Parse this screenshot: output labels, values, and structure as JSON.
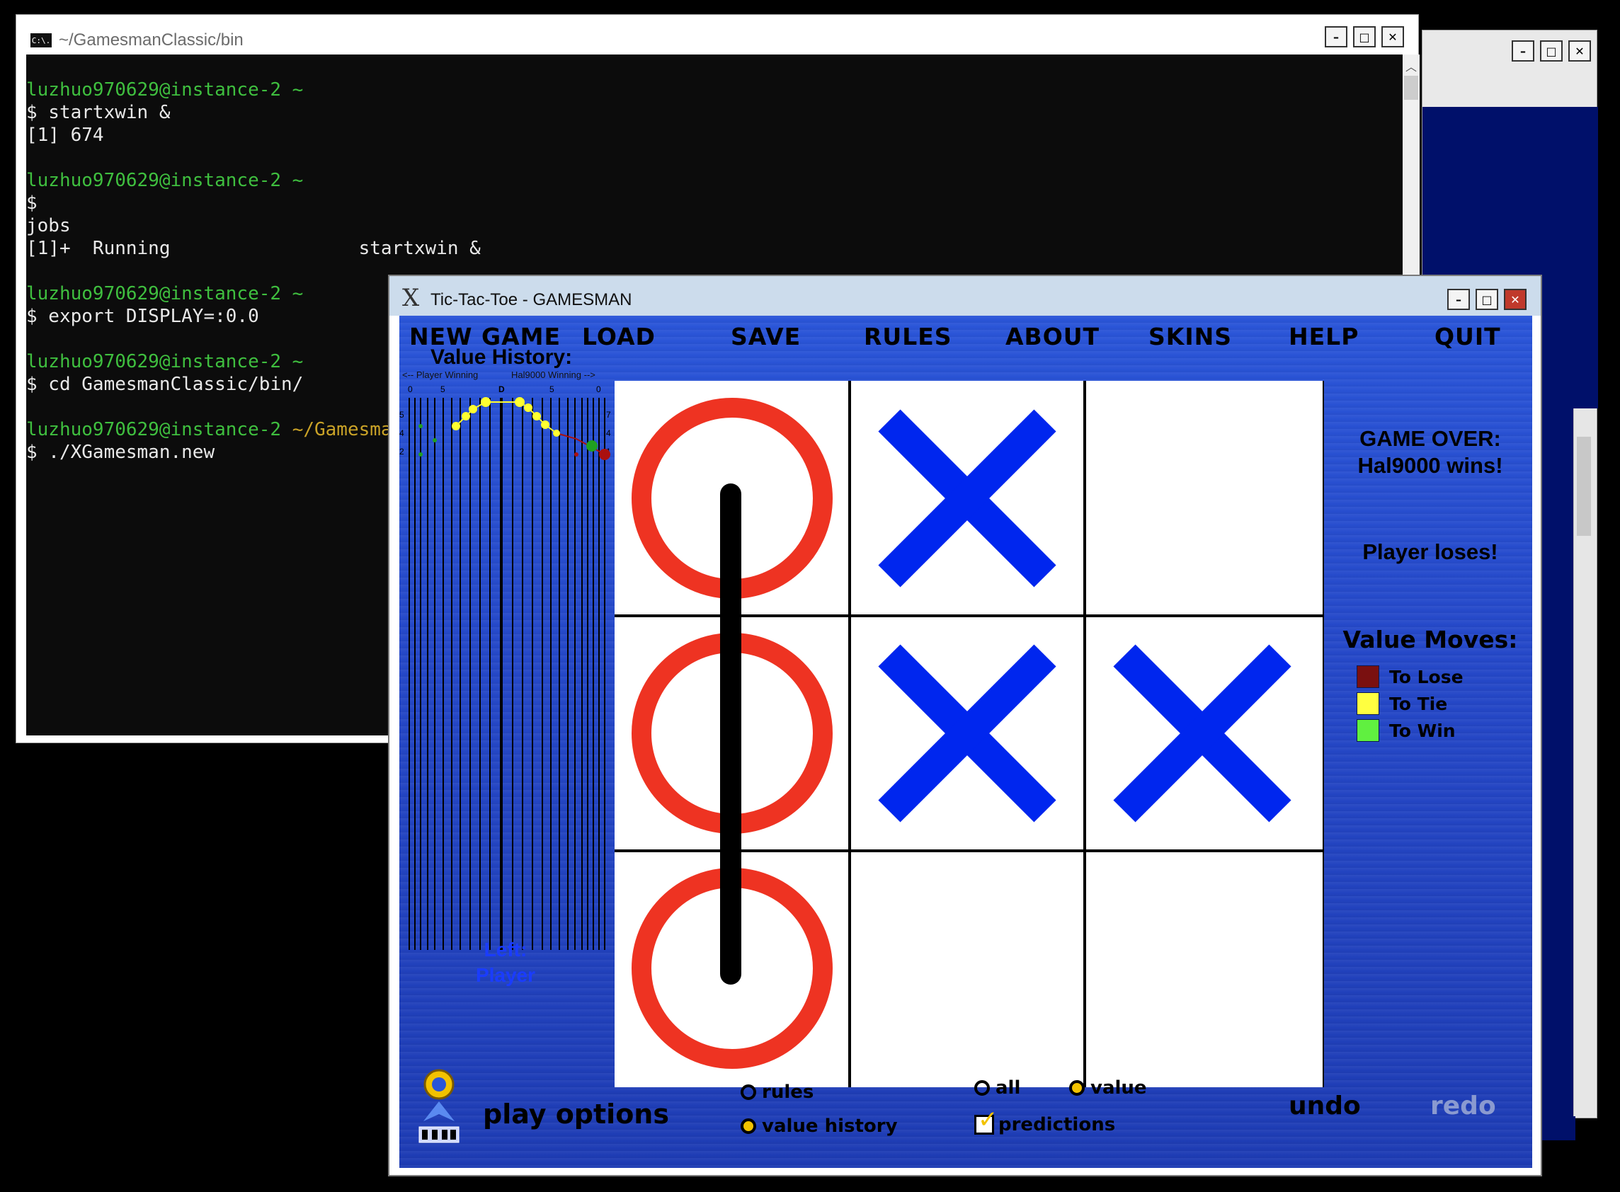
{
  "terminal": {
    "title": "~/GamesmanClassic/bin",
    "icon_label": "C:\\.",
    "lines": [
      {
        "text": "luzhuo970629@instance-2 ~",
        "color": "green"
      },
      {
        "text": "$ startxwin &",
        "color": "white"
      },
      {
        "text": "[1] 674",
        "color": "white"
      },
      {
        "text": "",
        "color": "white"
      },
      {
        "text": "luzhuo970629@instance-2 ~",
        "color": "green"
      },
      {
        "text": "$",
        "color": "white"
      },
      {
        "text": "jobs",
        "color": "white"
      },
      {
        "text": "[1]+  Running                 startxwin &",
        "color": "white"
      },
      {
        "text": "",
        "color": "white"
      },
      {
        "text": "luzhuo970629@instance-2 ~",
        "color": "green"
      },
      {
        "text": "$ export DISPLAY=:0.0",
        "color": "white"
      },
      {
        "text": "",
        "color": "white"
      },
      {
        "text": "luzhuo970629@instance-2 ~",
        "color": "green"
      },
      {
        "text": "$ cd GamesmanClassic/bin/",
        "color": "white"
      },
      {
        "text": "",
        "color": "white"
      },
      {
        "text": "luzhuo970629@instance-2 ",
        "color": "green",
        "suffix": "~/GamesmanClassic/bin"
      },
      {
        "text": "$ ./XGamesman.new",
        "color": "white"
      }
    ]
  },
  "window_buttons": {
    "minimize": "–",
    "maximize": "□",
    "close": "✕"
  },
  "gamesman": {
    "title": "Tic-Tac-Toe - GAMESMAN",
    "menu": [
      "NEW GAME",
      "LOAD",
      "SAVE",
      "RULES",
      "ABOUT",
      "SKINS",
      "HELP",
      "QUIT"
    ],
    "value_history": {
      "title": "Value History:",
      "left_caption": "<-- Player Winning",
      "right_caption": "Hal9000 Winning -->",
      "scale_top": [
        "0",
        "5",
        "D",
        "5",
        "0"
      ],
      "scale_left": [
        "5",
        "4",
        "2"
      ],
      "scale_right": [
        "7",
        "4",
        "1"
      ]
    },
    "turn_label_1": "Left:",
    "turn_label_2": "Player",
    "board": [
      "O",
      "X",
      "",
      "O",
      "X",
      "X",
      "O",
      "",
      ""
    ],
    "win_line": "left-column",
    "status": {
      "game_over": "GAME OVER:",
      "winner": "Hal9000 wins!",
      "loser": "Player loses!"
    },
    "legend": {
      "title": "Value Moves:",
      "items": [
        {
          "label": "To Lose",
          "color": "#7a1010"
        },
        {
          "label": "To Tie",
          "color": "#ffff40"
        },
        {
          "label": "To Win",
          "color": "#60f040"
        }
      ]
    },
    "bottom": {
      "play_options": "play options",
      "rules": "rules",
      "value_history": "value history",
      "all": "all",
      "value": "value",
      "predictions": "predictions",
      "undo": "undo",
      "redo": "redo"
    },
    "colors": {
      "o_color": "#ee3322",
      "x_color": "#0026ee",
      "accent": "#f2c200"
    }
  }
}
